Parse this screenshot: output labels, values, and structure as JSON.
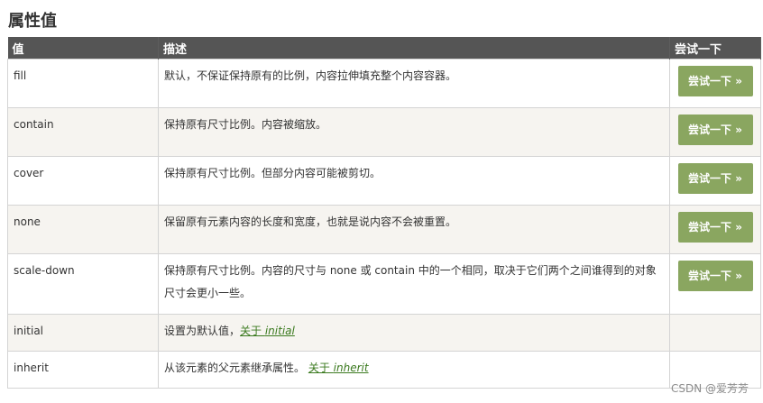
{
  "page": {
    "title": "属性值",
    "watermark": "CSDN @爱芳芳"
  },
  "table": {
    "headers": [
      "值",
      "描述",
      "尝试一下"
    ],
    "rows": [
      {
        "value": "fill",
        "description": "默认，不保证保持原有的比例，内容拉伸填充整个内容容器。",
        "button": "尝试一下 »"
      },
      {
        "value": "contain",
        "description": "保持原有尺寸比例。内容被缩放。",
        "button": "尝试一下 »"
      },
      {
        "value": "cover",
        "description": "保持原有尺寸比例。但部分内容可能被剪切。",
        "button": "尝试一下 »"
      },
      {
        "value": "none",
        "description": "保留原有元素内容的长度和宽度，也就是说内容不会被重置。",
        "button": "尝试一下 »"
      },
      {
        "value": "scale-down",
        "description": "保持原有尺寸比例。内容的尺寸与 none 或 contain 中的一个相同，取决于它们两个之间谁得到的对象尺寸会更小一些。",
        "button": "尝试一下 »"
      },
      {
        "value": "initial",
        "description": "设置为默认值，",
        "link_prefix": "关于 ",
        "link_text": "initial"
      },
      {
        "value": "inherit",
        "description": "从该元素的父元素继承属性。 ",
        "link_prefix": "关于 ",
        "link_text": "inherit"
      }
    ]
  }
}
